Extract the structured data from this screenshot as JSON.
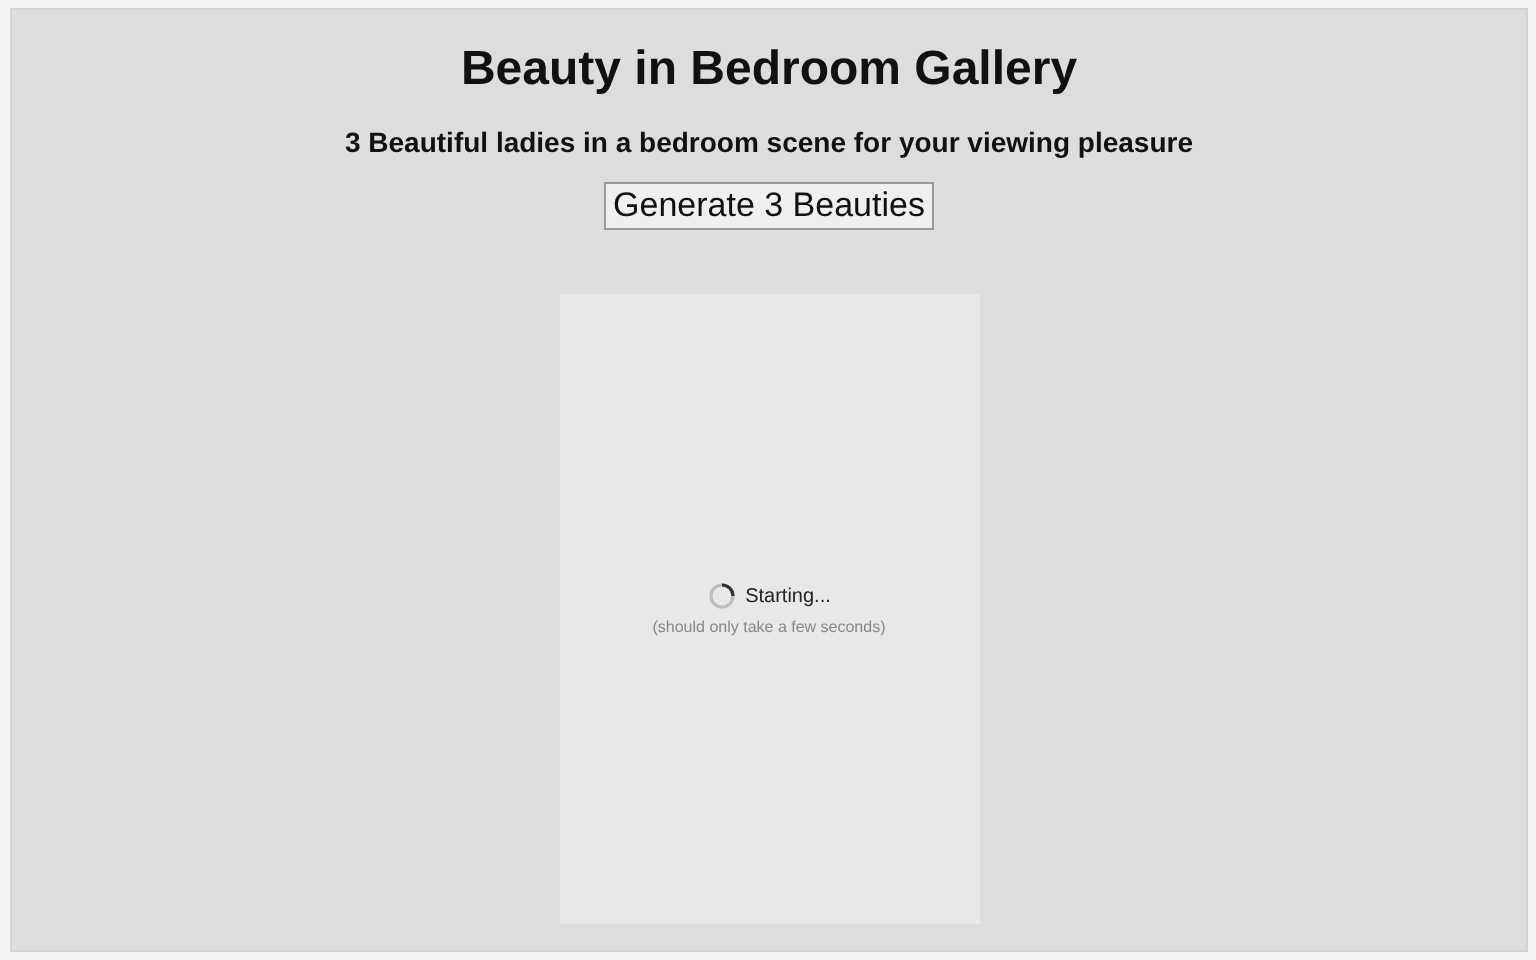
{
  "title": "Beauty in Bedroom Gallery",
  "subtitle": "3 Beautiful ladies in a bedroom scene for your viewing pleasure",
  "generate_button": "Generate 3 Beauties",
  "loader": {
    "status": "Starting...",
    "hint": "(should only take a few seconds)"
  }
}
